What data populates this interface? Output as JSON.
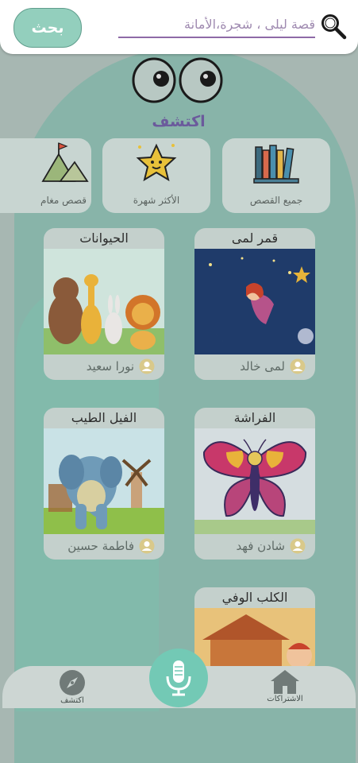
{
  "search": {
    "button_label": "بحث",
    "placeholder": "قصة ليلى ، شجرة،الأمانة"
  },
  "discover_title": "اكتشف",
  "categories": [
    {
      "label": "جميع القصص",
      "icon": "books-icon"
    },
    {
      "label": "الأكثر شهرة",
      "icon": "star-icon"
    },
    {
      "label": "قصص مغام",
      "icon": "mountain-flag-icon"
    }
  ],
  "stories": [
    {
      "title": "قمر لمى",
      "author": "لمى خالد",
      "cover": "moon-girl-cover"
    },
    {
      "title": "الحيوانات",
      "author": "نورا سعيد",
      "cover": "animals-cover"
    },
    {
      "title": "الفراشة",
      "author": "شادن فهد",
      "cover": "butterfly-cover"
    },
    {
      "title": "الفيل الطيب",
      "author": "فاطمة حسين",
      "cover": "elephant-cover"
    },
    {
      "title": "الكلب الوفي",
      "author": "",
      "cover": "dog-house-cover"
    }
  ],
  "bottom_nav": {
    "subscriptions_label": "الاشتراكات",
    "discover_label": "اكتشف"
  },
  "colors": {
    "accent_green": "#73c9b5",
    "title_purple": "#6b5a9c",
    "search_underline": "#8e6aa6"
  }
}
